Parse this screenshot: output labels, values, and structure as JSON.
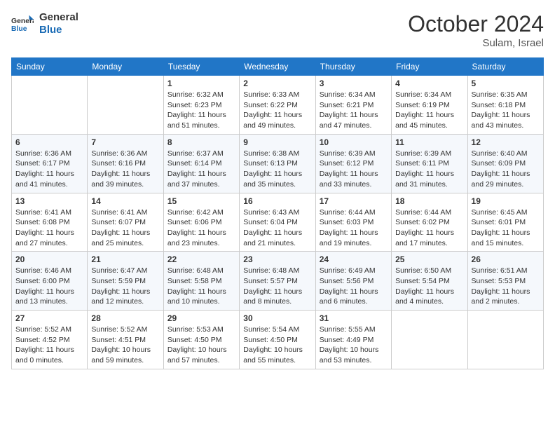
{
  "header": {
    "logo_general": "General",
    "logo_blue": "Blue",
    "month_title": "October 2024",
    "location": "Sulam, Israel"
  },
  "columns": [
    "Sunday",
    "Monday",
    "Tuesday",
    "Wednesday",
    "Thursday",
    "Friday",
    "Saturday"
  ],
  "weeks": [
    [
      {
        "day": "",
        "info": ""
      },
      {
        "day": "",
        "info": ""
      },
      {
        "day": "1",
        "info": "Sunrise: 6:32 AM\nSunset: 6:23 PM\nDaylight: 11 hours and 51 minutes."
      },
      {
        "day": "2",
        "info": "Sunrise: 6:33 AM\nSunset: 6:22 PM\nDaylight: 11 hours and 49 minutes."
      },
      {
        "day": "3",
        "info": "Sunrise: 6:34 AM\nSunset: 6:21 PM\nDaylight: 11 hours and 47 minutes."
      },
      {
        "day": "4",
        "info": "Sunrise: 6:34 AM\nSunset: 6:19 PM\nDaylight: 11 hours and 45 minutes."
      },
      {
        "day": "5",
        "info": "Sunrise: 6:35 AM\nSunset: 6:18 PM\nDaylight: 11 hours and 43 minutes."
      }
    ],
    [
      {
        "day": "6",
        "info": "Sunrise: 6:36 AM\nSunset: 6:17 PM\nDaylight: 11 hours and 41 minutes."
      },
      {
        "day": "7",
        "info": "Sunrise: 6:36 AM\nSunset: 6:16 PM\nDaylight: 11 hours and 39 minutes."
      },
      {
        "day": "8",
        "info": "Sunrise: 6:37 AM\nSunset: 6:14 PM\nDaylight: 11 hours and 37 minutes."
      },
      {
        "day": "9",
        "info": "Sunrise: 6:38 AM\nSunset: 6:13 PM\nDaylight: 11 hours and 35 minutes."
      },
      {
        "day": "10",
        "info": "Sunrise: 6:39 AM\nSunset: 6:12 PM\nDaylight: 11 hours and 33 minutes."
      },
      {
        "day": "11",
        "info": "Sunrise: 6:39 AM\nSunset: 6:11 PM\nDaylight: 11 hours and 31 minutes."
      },
      {
        "day": "12",
        "info": "Sunrise: 6:40 AM\nSunset: 6:09 PM\nDaylight: 11 hours and 29 minutes."
      }
    ],
    [
      {
        "day": "13",
        "info": "Sunrise: 6:41 AM\nSunset: 6:08 PM\nDaylight: 11 hours and 27 minutes."
      },
      {
        "day": "14",
        "info": "Sunrise: 6:41 AM\nSunset: 6:07 PM\nDaylight: 11 hours and 25 minutes."
      },
      {
        "day": "15",
        "info": "Sunrise: 6:42 AM\nSunset: 6:06 PM\nDaylight: 11 hours and 23 minutes."
      },
      {
        "day": "16",
        "info": "Sunrise: 6:43 AM\nSunset: 6:04 PM\nDaylight: 11 hours and 21 minutes."
      },
      {
        "day": "17",
        "info": "Sunrise: 6:44 AM\nSunset: 6:03 PM\nDaylight: 11 hours and 19 minutes."
      },
      {
        "day": "18",
        "info": "Sunrise: 6:44 AM\nSunset: 6:02 PM\nDaylight: 11 hours and 17 minutes."
      },
      {
        "day": "19",
        "info": "Sunrise: 6:45 AM\nSunset: 6:01 PM\nDaylight: 11 hours and 15 minutes."
      }
    ],
    [
      {
        "day": "20",
        "info": "Sunrise: 6:46 AM\nSunset: 6:00 PM\nDaylight: 11 hours and 13 minutes."
      },
      {
        "day": "21",
        "info": "Sunrise: 6:47 AM\nSunset: 5:59 PM\nDaylight: 11 hours and 12 minutes."
      },
      {
        "day": "22",
        "info": "Sunrise: 6:48 AM\nSunset: 5:58 PM\nDaylight: 11 hours and 10 minutes."
      },
      {
        "day": "23",
        "info": "Sunrise: 6:48 AM\nSunset: 5:57 PM\nDaylight: 11 hours and 8 minutes."
      },
      {
        "day": "24",
        "info": "Sunrise: 6:49 AM\nSunset: 5:56 PM\nDaylight: 11 hours and 6 minutes."
      },
      {
        "day": "25",
        "info": "Sunrise: 6:50 AM\nSunset: 5:54 PM\nDaylight: 11 hours and 4 minutes."
      },
      {
        "day": "26",
        "info": "Sunrise: 6:51 AM\nSunset: 5:53 PM\nDaylight: 11 hours and 2 minutes."
      }
    ],
    [
      {
        "day": "27",
        "info": "Sunrise: 5:52 AM\nSunset: 4:52 PM\nDaylight: 11 hours and 0 minutes."
      },
      {
        "day": "28",
        "info": "Sunrise: 5:52 AM\nSunset: 4:51 PM\nDaylight: 10 hours and 59 minutes."
      },
      {
        "day": "29",
        "info": "Sunrise: 5:53 AM\nSunset: 4:50 PM\nDaylight: 10 hours and 57 minutes."
      },
      {
        "day": "30",
        "info": "Sunrise: 5:54 AM\nSunset: 4:50 PM\nDaylight: 10 hours and 55 minutes."
      },
      {
        "day": "31",
        "info": "Sunrise: 5:55 AM\nSunset: 4:49 PM\nDaylight: 10 hours and 53 minutes."
      },
      {
        "day": "",
        "info": ""
      },
      {
        "day": "",
        "info": ""
      }
    ]
  ]
}
